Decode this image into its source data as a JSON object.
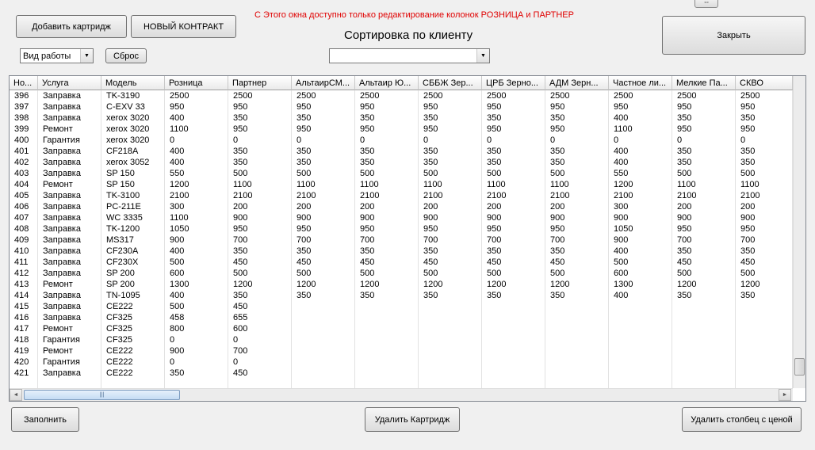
{
  "toolbar": {
    "add_cartridge": "Добавить картридж",
    "new_contract": "НОВЫЙ КОНТРАКТ",
    "close": "Закрыть",
    "reset": "Сброс",
    "work_type_value": "Вид работы",
    "notice": "С Этого окна доступно только редактирование колонок РОЗНИЦА и ПАРТНЕР",
    "sort_title": "Сортировка по клиенту",
    "client_value": ""
  },
  "footer": {
    "fill": "Заполнить",
    "delete_cartridge": "Удалить Картридж",
    "delete_price_column": "Удалить столбец с ценой"
  },
  "grid": {
    "columns": [
      "Но...",
      "Услуга",
      "Модель",
      "Розница",
      "Партнер",
      "АльтаирСМ...",
      "Альтаир Ю...",
      "СББЖ Зер...",
      "ЦРБ Зерно...",
      "АДМ Зерн...",
      "Частное ли...",
      "Мелкие Па...",
      "СКВО"
    ],
    "rows": [
      [
        "396",
        "Заправка",
        "TK-3190",
        "2500",
        "2500",
        "2500",
        "2500",
        "2500",
        "2500",
        "2500",
        "2500",
        "2500",
        "2500"
      ],
      [
        "397",
        "Заправка",
        "C-EXV 33",
        "950",
        "950",
        "950",
        "950",
        "950",
        "950",
        "950",
        "950",
        "950",
        "950"
      ],
      [
        "398",
        "Заправка",
        "xerox 3020",
        "400",
        "350",
        "350",
        "350",
        "350",
        "350",
        "350",
        "400",
        "350",
        "350"
      ],
      [
        "399",
        "Ремонт",
        "xerox 3020",
        "1100",
        "950",
        "950",
        "950",
        "950",
        "950",
        "950",
        "1100",
        "950",
        "950"
      ],
      [
        "400",
        "Гарантия",
        "xerox 3020",
        "0",
        "0",
        "0",
        "0",
        "0",
        "0",
        "0",
        "0",
        "0",
        "0"
      ],
      [
        "401",
        "Заправка",
        "CF218A",
        "400",
        "350",
        "350",
        "350",
        "350",
        "350",
        "350",
        "400",
        "350",
        "350"
      ],
      [
        "402",
        "Заправка",
        "xerox 3052",
        "400",
        "350",
        "350",
        "350",
        "350",
        "350",
        "350",
        "400",
        "350",
        "350"
      ],
      [
        "403",
        "Заправка",
        "SP 150",
        "550",
        "500",
        "500",
        "500",
        "500",
        "500",
        "500",
        "550",
        "500",
        "500"
      ],
      [
        "404",
        "Ремонт",
        "SP 150",
        "1200",
        "1100",
        "1100",
        "1100",
        "1100",
        "1100",
        "1100",
        "1200",
        "1100",
        "1100"
      ],
      [
        "405",
        "Заправка",
        "TK-3100",
        "2100",
        "2100",
        "2100",
        "2100",
        "2100",
        "2100",
        "2100",
        "2100",
        "2100",
        "2100"
      ],
      [
        "406",
        "Заправка",
        "PC-211E",
        "300",
        "200",
        "200",
        "200",
        "200",
        "200",
        "200",
        "300",
        "200",
        "200"
      ],
      [
        "407",
        "Заправка",
        "WC 3335",
        "1100",
        "900",
        "900",
        "900",
        "900",
        "900",
        "900",
        "900",
        "900",
        "900"
      ],
      [
        "408",
        "Заправка",
        "TK-1200",
        "1050",
        "950",
        "950",
        "950",
        "950",
        "950",
        "950",
        "1050",
        "950",
        "950"
      ],
      [
        "409",
        "Заправка",
        "MS317",
        "900",
        "700",
        "700",
        "700",
        "700",
        "700",
        "700",
        "900",
        "700",
        "700"
      ],
      [
        "410",
        "Заправка",
        "CF230A",
        "400",
        "350",
        "350",
        "350",
        "350",
        "350",
        "350",
        "400",
        "350",
        "350"
      ],
      [
        "411",
        "Заправка",
        "CF230X",
        "500",
        "450",
        "450",
        "450",
        "450",
        "450",
        "450",
        "500",
        "450",
        "450"
      ],
      [
        "412",
        "Заправка",
        "SP 200",
        "600",
        "500",
        "500",
        "500",
        "500",
        "500",
        "500",
        "600",
        "500",
        "500"
      ],
      [
        "413",
        "Ремонт",
        "SP 200",
        "1300",
        "1200",
        "1200",
        "1200",
        "1200",
        "1200",
        "1200",
        "1300",
        "1200",
        "1200"
      ],
      [
        "414",
        "Заправка",
        "TN-1095",
        "400",
        "350",
        "350",
        "350",
        "350",
        "350",
        "350",
        "400",
        "350",
        "350"
      ],
      [
        "415",
        "Заправка",
        "CE222",
        "500",
        "450",
        "",
        "",
        "",
        "",
        "",
        "",
        "",
        ""
      ],
      [
        "416",
        "Заправка",
        "CF325",
        "458",
        "655",
        "",
        "",
        "",
        "",
        "",
        "",
        "",
        ""
      ],
      [
        "417",
        "Ремонт",
        "CF325",
        "800",
        "600",
        "",
        "",
        "",
        "",
        "",
        "",
        "",
        ""
      ],
      [
        "418",
        "Гарантия",
        "CF325",
        "0",
        "0",
        "",
        "",
        "",
        "",
        "",
        "",
        "",
        ""
      ],
      [
        "419",
        "Ремонт",
        "CE222",
        "900",
        "700",
        "",
        "",
        "",
        "",
        "",
        "",
        "",
        ""
      ],
      [
        "420",
        "Гарантия",
        "CE222",
        "0",
        "0",
        "",
        "",
        "",
        "",
        "",
        "",
        "",
        ""
      ],
      [
        "421",
        "Заправка",
        "CE222",
        "350",
        "450",
        "",
        "",
        "",
        "",
        "",
        "",
        "",
        ""
      ]
    ]
  },
  "icons": {
    "top_handle": "restore-icon",
    "dropdown": "chevron-down-icon",
    "scroll_left": "arrow-left-icon",
    "scroll_right": "arrow-right-icon",
    "scroll_grip": "grip-icon"
  }
}
